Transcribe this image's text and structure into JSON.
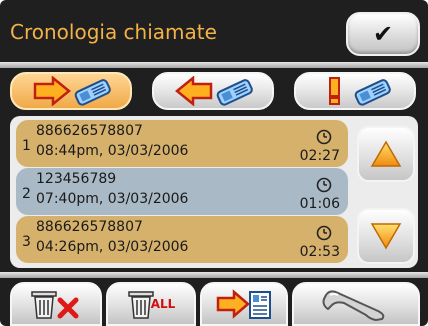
{
  "header": {
    "title": "Cronologia chiamate"
  },
  "tabs": [
    {
      "name": "outgoing-calls",
      "active": true
    },
    {
      "name": "incoming-calls",
      "active": false
    },
    {
      "name": "missed-calls",
      "active": false
    }
  ],
  "calls": [
    {
      "index": "1",
      "number": "886626578807",
      "datetime": "08:44pm, 03/03/2006",
      "duration": "02:27",
      "color": "#d6b16c"
    },
    {
      "index": "2",
      "number": "123456789",
      "datetime": "07:40pm, 03/03/2006",
      "duration": "01:06",
      "color": "#a9bac6"
    },
    {
      "index": "3",
      "number": "886626578807",
      "datetime": "04:26pm, 03/03/2006",
      "duration": "02:53",
      "color": "#d6b16c"
    }
  ],
  "bottom_bar": {
    "delete_all_label": "ALL"
  },
  "colors": {
    "accent": "#f3b248",
    "background": "#1f1f1f"
  }
}
